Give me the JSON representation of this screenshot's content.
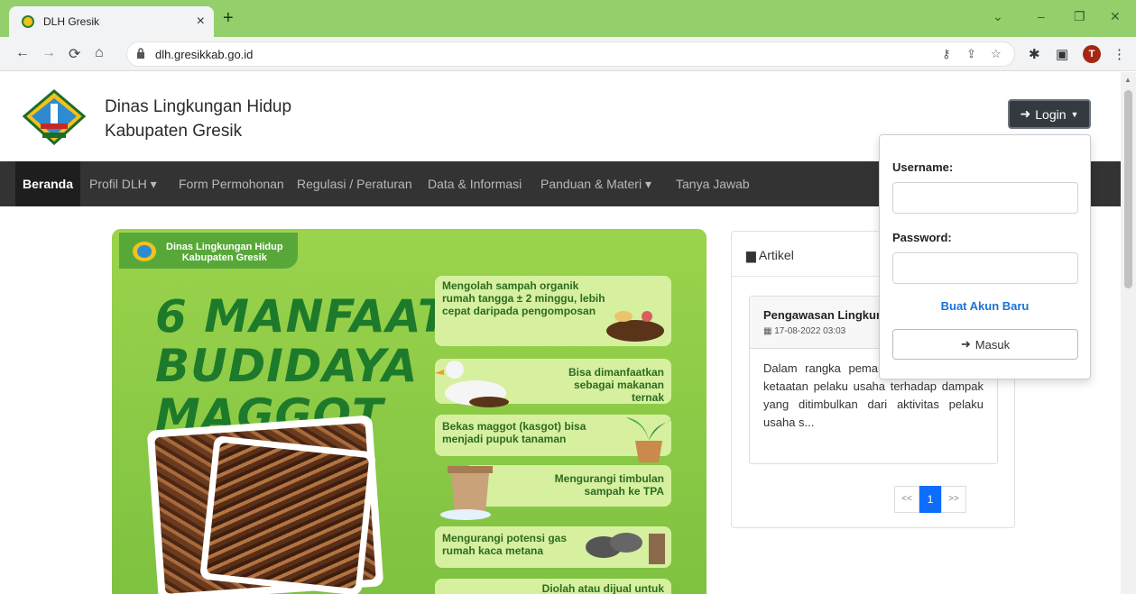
{
  "browser": {
    "tab_title": "DLH Gresik",
    "tab_close": "×",
    "new_tab": "+",
    "url": "dlh.gresikkab.go.id",
    "window_controls": [
      "⌄",
      "–",
      "❐",
      "✕"
    ],
    "profile_initial": "T",
    "icons": [
      "back-icon",
      "forward-icon",
      "reload-icon",
      "home-icon",
      "lock-icon",
      "key-icon",
      "share-icon",
      "star-icon",
      "extensions-icon",
      "sidepanel-icon",
      "menu-icon"
    ]
  },
  "site": {
    "title_line1": "Dinas Lingkungan Hidup",
    "title_line2": "Kabupaten Gresik",
    "login_label": "Login"
  },
  "nav": {
    "items": [
      {
        "label": "Beranda"
      },
      {
        "label": "Profil DLH ▾"
      },
      {
        "label": "Form Permohonan"
      },
      {
        "label": "Regulasi / Peraturan"
      },
      {
        "label": "Data & Informasi"
      },
      {
        "label": "Panduan & Materi ▾"
      },
      {
        "label": "Tanya Jawab"
      }
    ]
  },
  "banner": {
    "badge_line1": "Dinas Lingkungan Hidup",
    "badge_line2": "Kabupaten Gresik",
    "headline": [
      "6 MANFAAT",
      "BUDIDAYA",
      "MAGGOT"
    ],
    "benefits": [
      "Mengolah sampah organik rumah tangga ± 2 minggu, lebih cepat daripada pengomposan",
      "Bisa dimanfaatkan sebagai makanan ternak",
      "Bekas maggot (kasgot) bisa menjadi pupuk tanaman",
      "Mengurangi timbulan sampah ke TPA",
      "Mengurangi potensi gas rumah kaca metana",
      "Diolah atau dijual untuk"
    ]
  },
  "article": {
    "panel_title": "Artikel",
    "card_title": "Pengawasan Lingkungan",
    "card_date": "17-08-2022 03:03",
    "card_excerpt": "Dalam rangka pemantauan pemenuhan ketaatan pelaku usaha terhadap dampak yang ditimbulkan dari aktivitas pelaku usaha s...",
    "pager": [
      "<<",
      "1",
      ">>"
    ]
  },
  "login": {
    "username_label": "Username:",
    "username_value": "",
    "password_label": "Password:",
    "password_value": "",
    "signup_label": "Buat Akun Baru",
    "submit_label": "Masuk"
  }
}
